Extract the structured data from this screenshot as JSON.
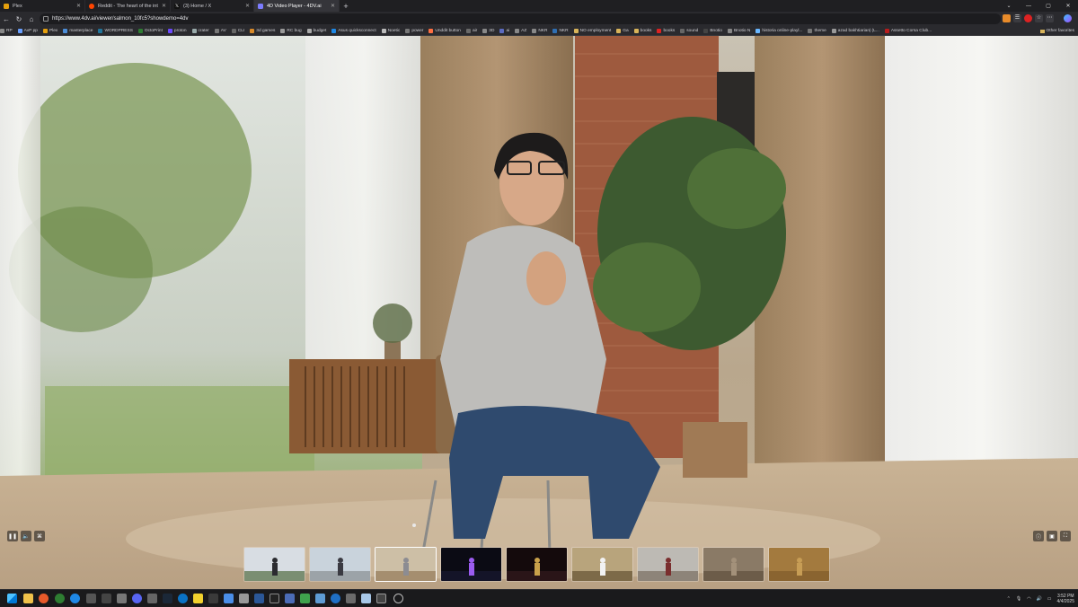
{
  "browser": {
    "tabs": [
      {
        "title": "Plex",
        "color": "#e5a00d",
        "active": false
      },
      {
        "title": "Reddit - The heart of the internet",
        "color": "#ff4500",
        "active": false
      },
      {
        "title": "(3) Home / X",
        "color": "#111111",
        "active": false
      },
      {
        "title": "4D Video Player - 4DV.ai",
        "color": "#7c7cff",
        "active": true
      }
    ],
    "new_tab": "+",
    "url": "https://www.4dv.ai/viewer/salmon_10fc5?showdemo=4dv",
    "bookmarks": [
      "RP",
      "AvP pp",
      "Plex",
      "masterplace",
      "WORDPRESS",
      "OctoPrint",
      "proton",
      "crater",
      "AV",
      "CLI",
      "3d games",
      "RC bug",
      "budget",
      "Asus quicksconnect",
      "Noetic",
      "power",
      "Unddit button",
      "air",
      "3D",
      "ai",
      "AZ",
      "NKR",
      "NKR",
      "NO employment",
      "Ga",
      "books",
      "books",
      "sound",
      "Bnotio",
      "Bnotio N",
      "historia online-playl...",
      "theme",
      "azad bakhtiarian| (L...",
      "Assetto Corsa Club..."
    ],
    "other_favorites": "Other favorites"
  },
  "player": {
    "controls_left": [
      "pause-icon",
      "volume-icon",
      "vr-icon"
    ],
    "controls_right": [
      "info-icon",
      "camera-icon",
      "fullscreen-icon"
    ],
    "thumbnails": [
      {
        "name": "dancers-outdoor",
        "sky": "#d8dde3",
        "ground": "#7a8e72",
        "figure": "#2b2b30"
      },
      {
        "name": "parking-lot",
        "sky": "#c9d3dc",
        "ground": "#9ca3a8",
        "figure": "#3a3a42"
      },
      {
        "name": "living-room-speaker",
        "sky": "#cdbfa6",
        "ground": "#a58e6f",
        "figure": "#8c8c92",
        "selected": true
      },
      {
        "name": "stage-dancer-purple",
        "sky": "#0b0b14",
        "ground": "#141428",
        "figure": "#9b5cf0"
      },
      {
        "name": "musicians-stage",
        "sky": "#140a0c",
        "ground": "#2a1518",
        "figure": "#c9a14a"
      },
      {
        "name": "library-dancer",
        "sky": "#b8a47c",
        "ground": "#7d6a48",
        "figure": "#f2f2f2"
      },
      {
        "name": "courtyard-dancer",
        "sky": "#bdbab4",
        "ground": "#8d8479",
        "figure": "#7a2e2e"
      },
      {
        "name": "stone-sculpture",
        "sky": "#8a7a66",
        "ground": "#6c5c49",
        "figure": "#a3917a"
      },
      {
        "name": "golden-relief",
        "sky": "#a37a3e",
        "ground": "#8a6430",
        "figure": "#c79d55"
      }
    ]
  },
  "taskbar": {
    "time": "3:52 PM",
    "date": "4/4/2025"
  }
}
